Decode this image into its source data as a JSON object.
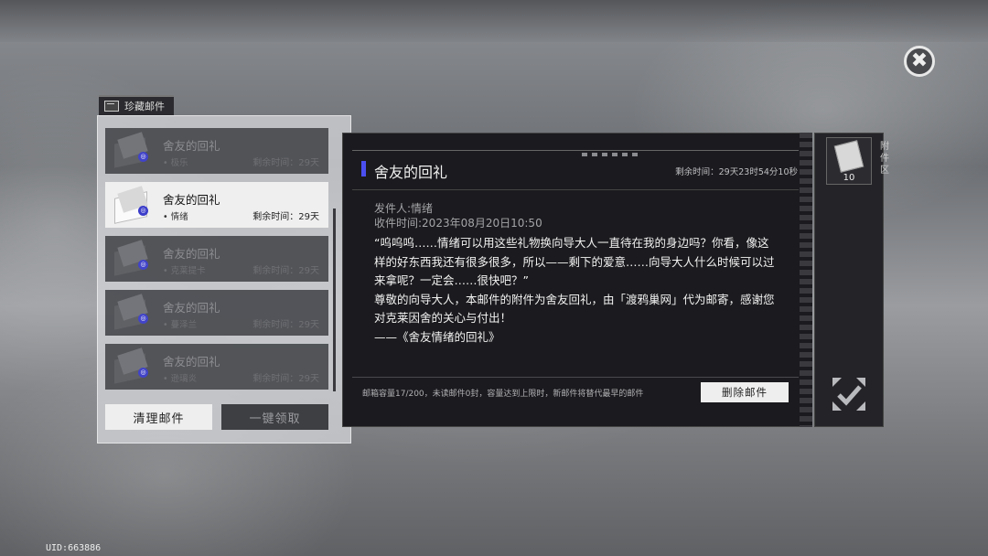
{
  "header": {
    "tab_label": "珍藏邮件",
    "close_icon": "close-x-icon"
  },
  "mail_list": [
    {
      "title": "舍友的回礼",
      "sender": "• 极乐",
      "remaining": "剩余时间：29天",
      "selected": false
    },
    {
      "title": "舍友的回礼",
      "sender": "• 情绪",
      "remaining": "剩余时间：29天",
      "selected": true
    },
    {
      "title": "舍友的回礼",
      "sender": "• 克莱提卡",
      "remaining": "剩余时间：29天",
      "selected": false
    },
    {
      "title": "舍友的回礼",
      "sender": "• 蔓泽兰",
      "remaining": "剩余时间：29天",
      "selected": false
    },
    {
      "title": "舍友的回礼",
      "sender": "• 逊璃炎",
      "remaining": "剩余时间：29天",
      "selected": false
    }
  ],
  "buttons": {
    "clean": "清理邮件",
    "claim_all": "一键领取",
    "delete": "删除邮件"
  },
  "mail": {
    "title": "舍友的回礼",
    "remaining_full": "剩余时间：29天23时54分10秒",
    "sender_line": "发件人:情绪",
    "received_line": "收件时间:2023年08月20日10:50",
    "body": [
      "“呜呜呜……情绪可以用这些礼物换向导大人一直待在我的身边吗？你看，像这样的好东西我还有很多很多，所以——剩下的爱意……向导大人什么时候可以过来拿呢？一定会……很快吧？”",
      "尊敬的向导大人，本邮件的附件为舍友回礼，由「渡鸦巢网」代为邮寄，感谢您对克莱因舍的关心与付出！",
      "——《舍友情绪的回礼》"
    ],
    "capacity_note": "邮箱容量17/200，未读邮件0封，容量达到上限时，新邮件将替代最早的邮件"
  },
  "attachment": {
    "label": "附件区",
    "count": "10"
  },
  "footer": {
    "uid": "UID:663886"
  },
  "colors": {
    "accent": "#4b4ff0",
    "panel": "#1b1a1e",
    "selected_item": "#efefef"
  }
}
